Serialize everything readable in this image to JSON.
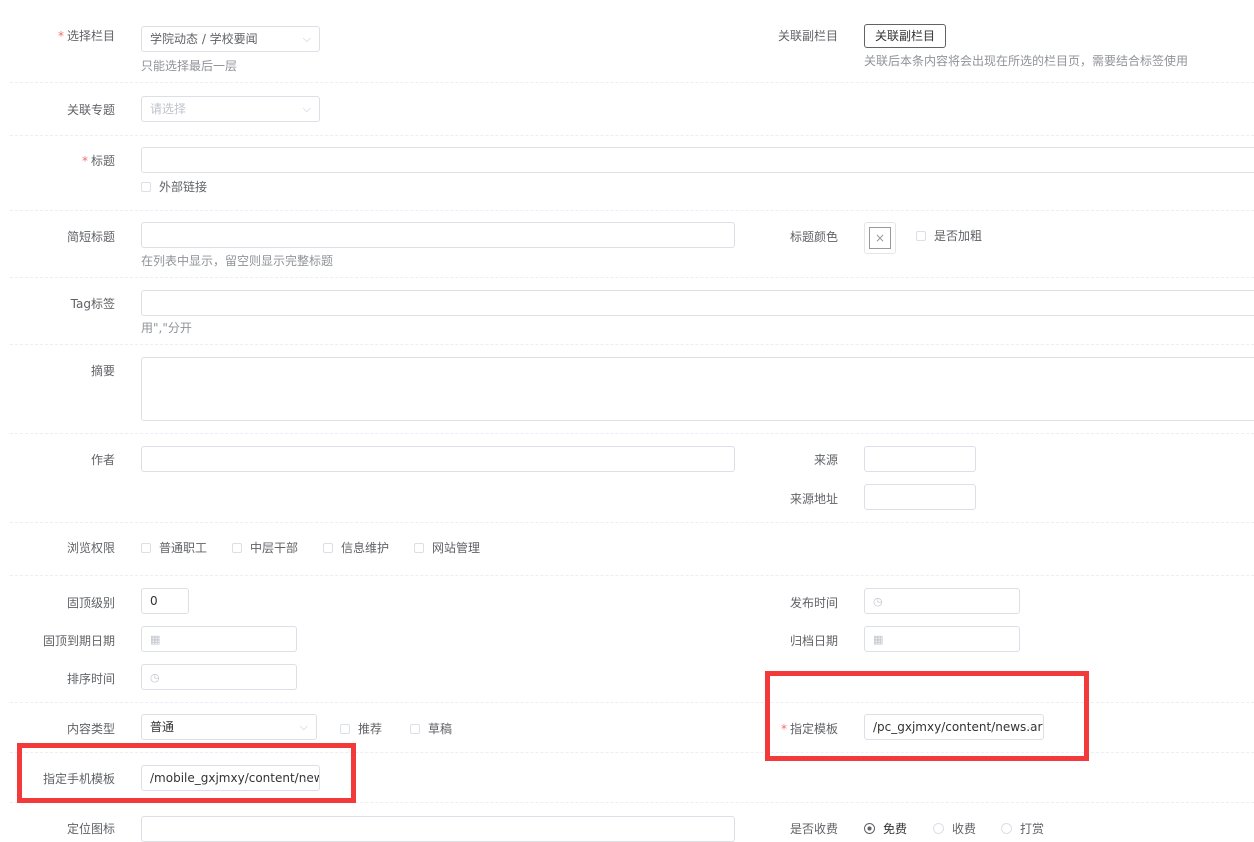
{
  "column": {
    "label": "选择栏目",
    "value": "学院动态 / 学校要闻",
    "hint": "只能选择最后一层"
  },
  "sub_column": {
    "label": "关联副栏目",
    "button": "关联副栏目",
    "hint": "关联后本条内容将会出现在所选的栏目页，需要结合标签使用"
  },
  "topic": {
    "label": "关联专题",
    "placeholder": "请选择"
  },
  "title": {
    "label": "标题",
    "value": "",
    "external_link": "外部链接"
  },
  "short_title": {
    "label": "简短标题",
    "value": "",
    "hint": "在列表中显示，留空则显示完整标题"
  },
  "title_color": {
    "label": "标题颜色",
    "clear_glyph": "×",
    "bold": "是否加粗"
  },
  "tags": {
    "label": "Tag标签",
    "hint": "用\",\"分开"
  },
  "summary": {
    "label": "摘要"
  },
  "author": {
    "label": "作者"
  },
  "source": {
    "label": "来源"
  },
  "source_url": {
    "label": "来源地址"
  },
  "permissions": {
    "label": "浏览权限",
    "options": [
      "普通职工",
      "中层干部",
      "信息维护",
      "网站管理"
    ]
  },
  "top_level": {
    "label": "固顶级别",
    "value": "0"
  },
  "publish_time": {
    "label": "发布时间"
  },
  "top_expire": {
    "label": "固顶到期日期"
  },
  "archive_date": {
    "label": "归档日期"
  },
  "sort_time": {
    "label": "排序时间"
  },
  "content_type": {
    "label": "内容类型",
    "value": "普通",
    "recommend": "推荐",
    "draft": "草稿"
  },
  "template": {
    "label": "指定模板",
    "value": "/pc_gxjmxy/content/news.ar"
  },
  "mobile_template": {
    "label": "指定手机模板",
    "value": "/mobile_gxjmxy/content/new"
  },
  "locate_icon": {
    "label": "定位图标"
  },
  "charge": {
    "label": "是否收费",
    "options": [
      "免费",
      "收费",
      "打赏"
    ],
    "selected": "免费"
  },
  "icons": {
    "chevron": "⌵",
    "clock": "◷",
    "calendar": "▦"
  }
}
